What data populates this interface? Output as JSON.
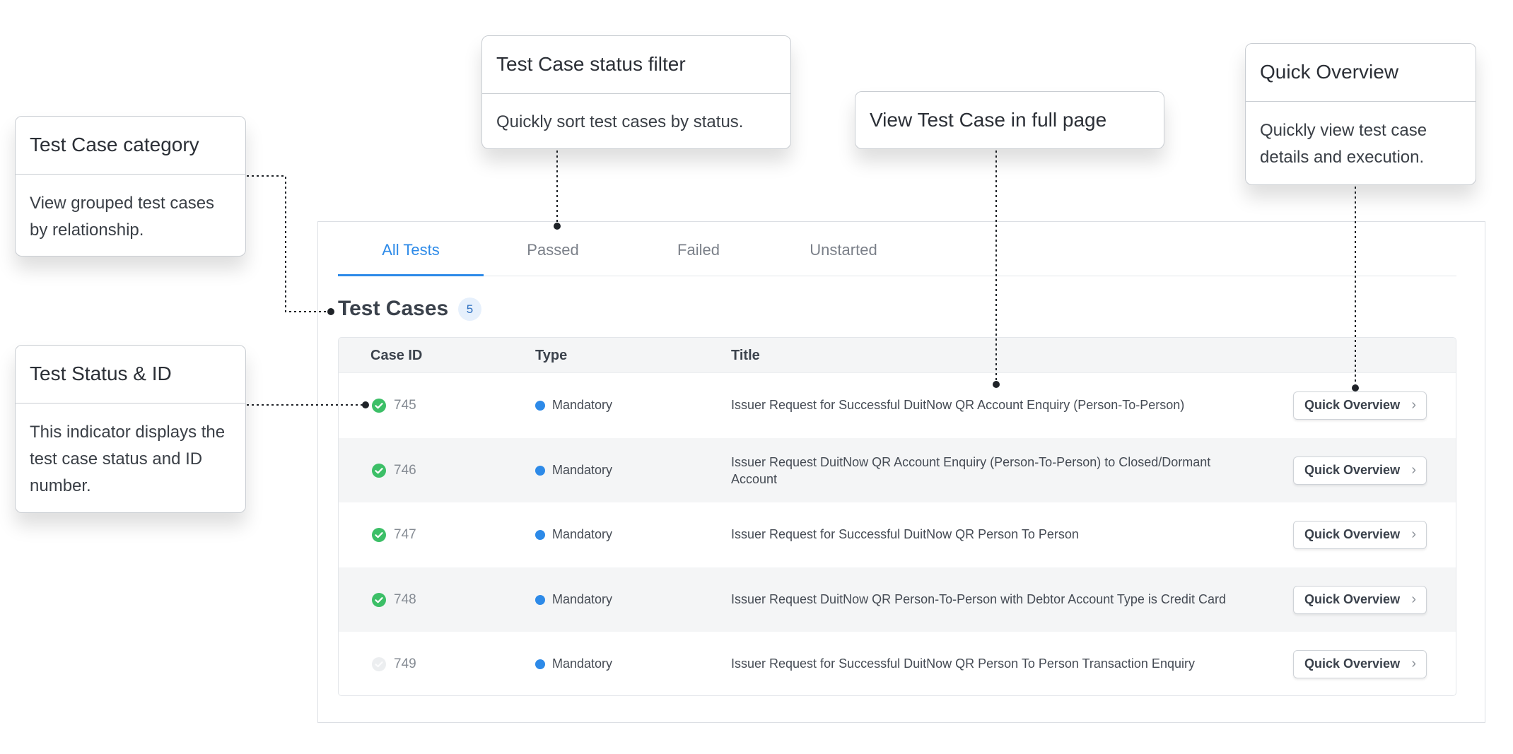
{
  "tabs": [
    {
      "label": "All Tests",
      "active": true
    },
    {
      "label": "Passed",
      "active": false
    },
    {
      "label": "Failed",
      "active": false
    },
    {
      "label": "Unstarted",
      "active": false
    }
  ],
  "section": {
    "title": "Test Cases",
    "count": "5"
  },
  "table": {
    "headers": {
      "case_id": "Case ID",
      "type": "Type",
      "title": "Title"
    },
    "rows": [
      {
        "id": "745",
        "status": "passed",
        "type": "Mandatory",
        "title": "Issuer Request for Successful DuitNow QR Account Enquiry (Person-To-Person)",
        "action": "Quick Overview"
      },
      {
        "id": "746",
        "status": "passed",
        "type": "Mandatory",
        "title": "Issuer Request DuitNow QR Account Enquiry (Person-To-Person) to Closed/Dormant Account",
        "action": "Quick Overview"
      },
      {
        "id": "747",
        "status": "passed",
        "type": "Mandatory",
        "title": "Issuer Request for Successful DuitNow QR Person To Person",
        "action": "Quick Overview"
      },
      {
        "id": "748",
        "status": "passed",
        "type": "Mandatory",
        "title": "Issuer Request DuitNow QR Person-To-Person with Debtor Account Type is Credit Card",
        "action": "Quick Overview"
      },
      {
        "id": "749",
        "status": "unstarted",
        "type": "Mandatory",
        "title": "Issuer Request for Successful DuitNow QR Person To Person Transaction Enquiry",
        "action": "Quick Overview"
      }
    ]
  },
  "callouts": {
    "category": {
      "title": "Test Case category",
      "body": "View grouped test cases by relationship."
    },
    "status_filter": {
      "title": "Test Case status filter",
      "body": "Quickly sort test cases by status."
    },
    "full_page": {
      "title": "View Test Case in full page"
    },
    "quick_overview": {
      "title": "Quick Overview",
      "body": "Quickly view test case details and execution."
    },
    "status_id": {
      "title": "Test Status & ID",
      "body": "This indicator displays the test case status and ID number."
    }
  },
  "icons": {
    "passed": "check-circle-icon",
    "unstarted": "empty-circle-icon",
    "action": "chevron-right-icon"
  },
  "colors": {
    "accent": "#2d8ae8",
    "passed": "#3cbf67",
    "unstarted": "#eceef0",
    "type_dot": "#2d8ae8"
  }
}
